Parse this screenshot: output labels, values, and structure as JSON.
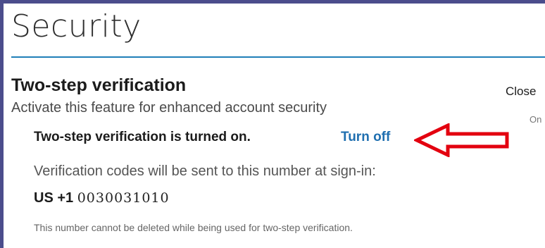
{
  "page": {
    "title": "Security"
  },
  "two_step": {
    "heading": "Two-step verification",
    "description": "Activate this feature for enhanced account security",
    "status": "Two-step verification is turned on.",
    "turn_off_label": "Turn off",
    "codes_text": "Verification codes will be sent to this number at sign-in:",
    "phone_prefix": "US +1",
    "phone_number": "0030031010",
    "note": "This number cannot be deleted while being used for two-step verification."
  },
  "right_panel": {
    "close_label": "Close",
    "on_label": "On"
  },
  "colors": {
    "frame_border": "#4b4d8c",
    "accent_link": "#1f6fb0",
    "title_rule": "#1f7fb8",
    "annotation_arrow": "#e3000f"
  },
  "annotation": {
    "icon": "red-arrow-icon"
  }
}
